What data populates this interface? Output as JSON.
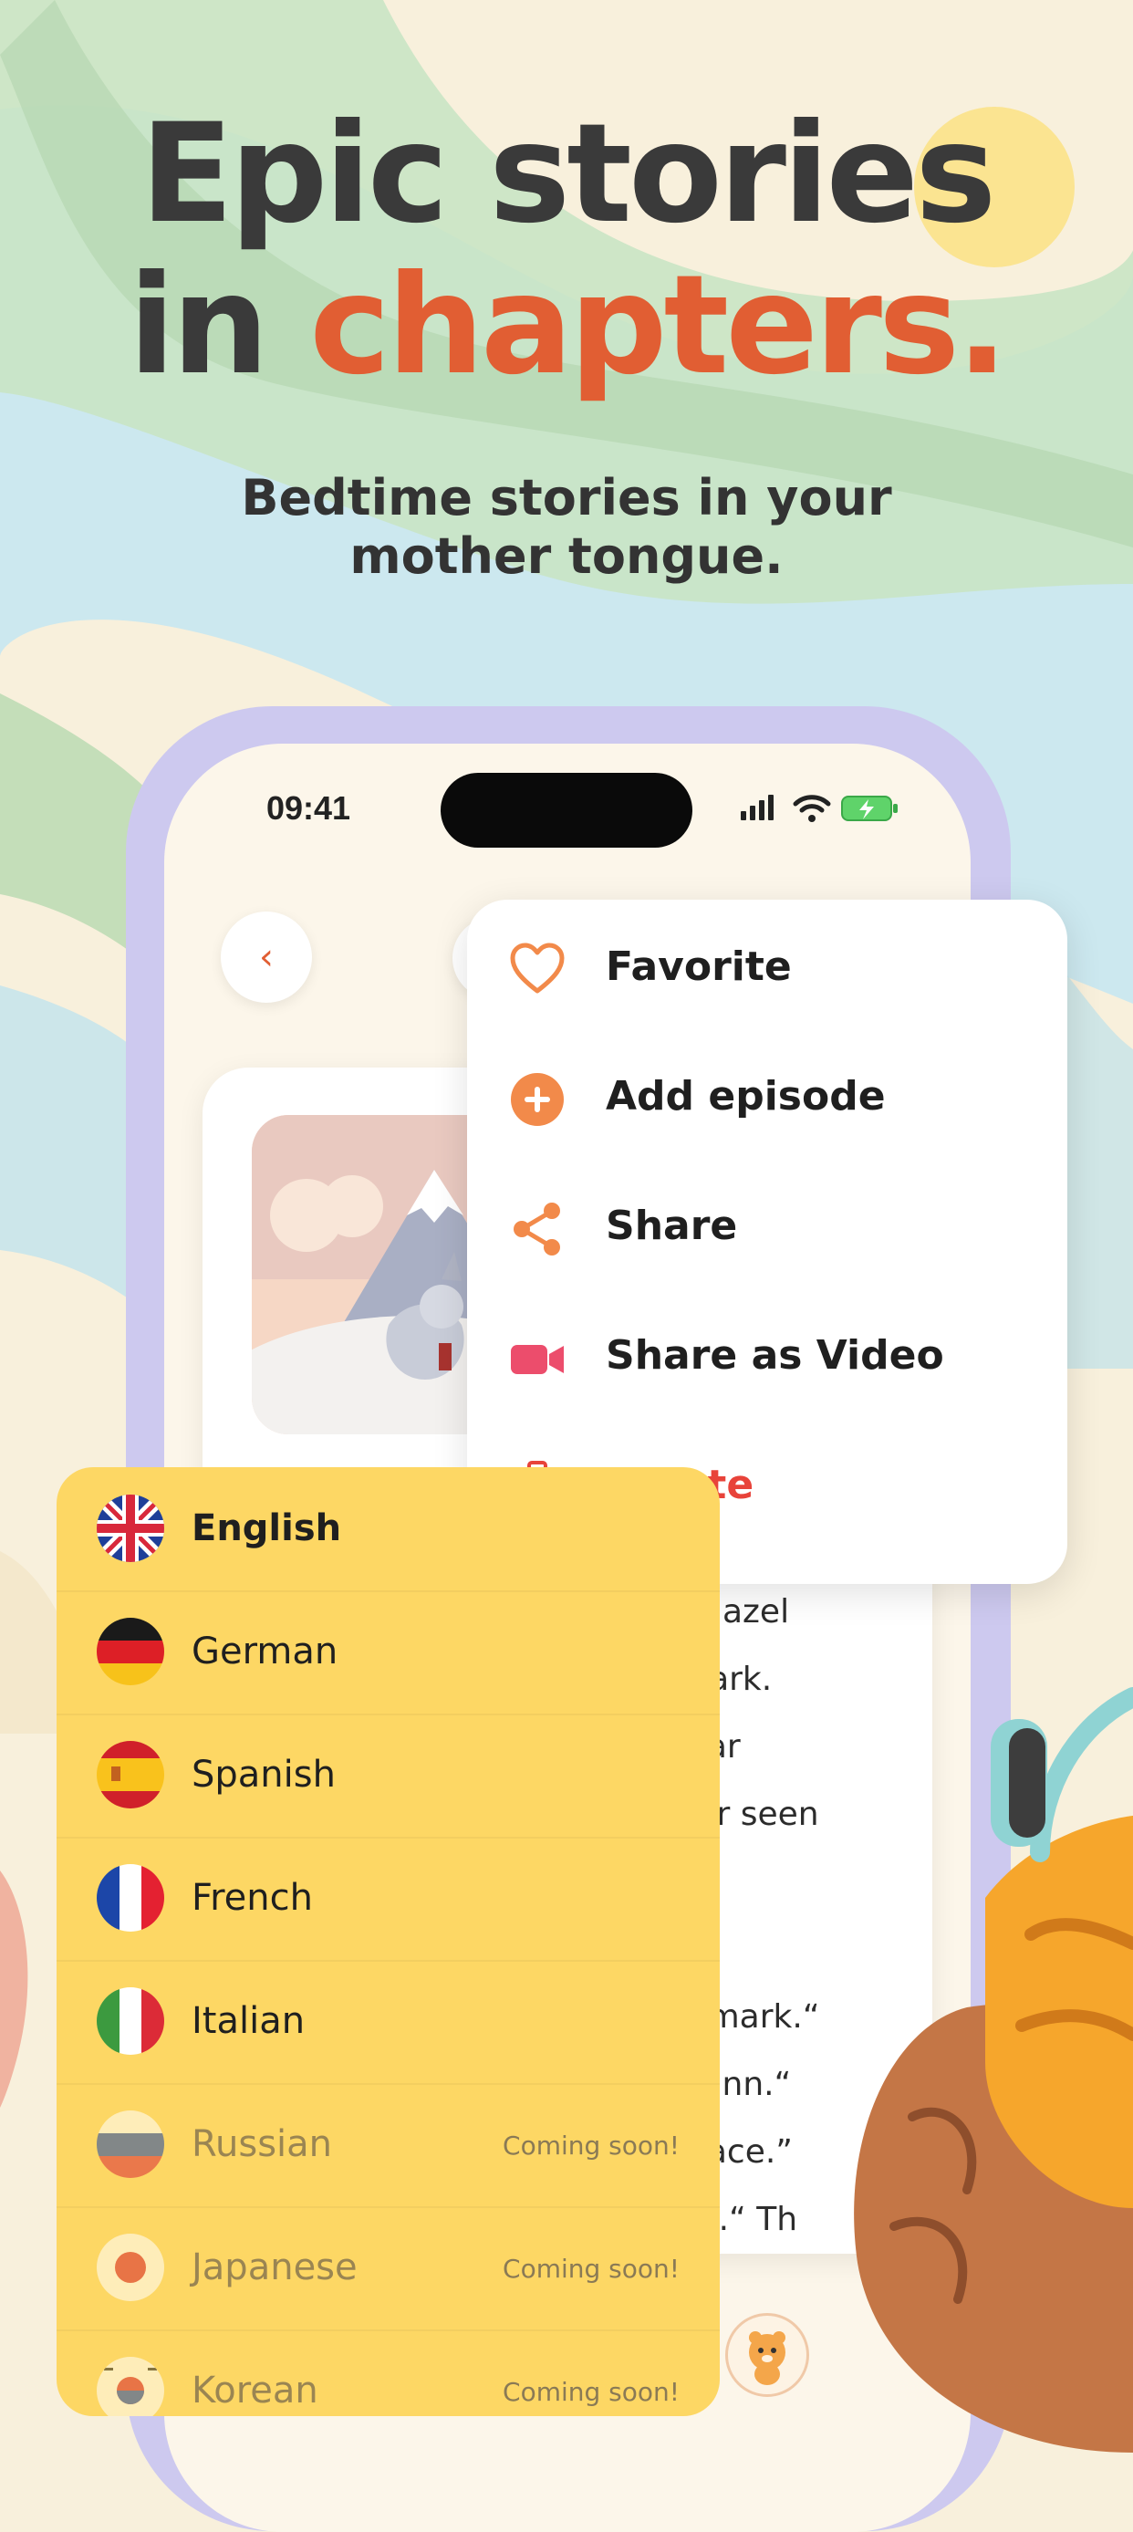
{
  "headline": {
    "line1": "Epic stories",
    "line2_prefix": "in ",
    "line2_accent": "chapters."
  },
  "subheadline": {
    "line1": "Bedtime stories in your",
    "line2": "mother tongue."
  },
  "status_bar": {
    "time": "09:41"
  },
  "story": {
    "text_lines": [
      ", Hazel",
      "mark.",
      "star",
      "ver seen",
      "",
      "",
      "e mark.“",
      "l Finn.“",
      "place.”",
      "up.“ Th"
    ]
  },
  "menu": {
    "items": [
      {
        "label": "Favorite",
        "icon": "heart-icon"
      },
      {
        "label": "Add episode",
        "icon": "plus-circle-icon"
      },
      {
        "label": "Share",
        "icon": "share-icon"
      },
      {
        "label": "Share as Video",
        "icon": "video-camera-icon"
      },
      {
        "label": "Delete",
        "icon": "trash-icon"
      }
    ]
  },
  "languages": {
    "items": [
      {
        "name": "English",
        "flag": "uk-flag-icon",
        "selected": true
      },
      {
        "name": "German",
        "flag": "germany-flag-icon"
      },
      {
        "name": "Spanish",
        "flag": "spain-flag-icon"
      },
      {
        "name": "French",
        "flag": "france-flag-icon"
      },
      {
        "name": "Italian",
        "flag": "italy-flag-icon"
      },
      {
        "name": "Russian",
        "flag": "russia-flag-icon",
        "status": "Coming soon!"
      },
      {
        "name": "Japanese",
        "flag": "japan-flag-icon",
        "status": "Coming soon!"
      },
      {
        "name": "Korean",
        "flag": "korea-flag-icon",
        "status": "Coming soon!"
      }
    ]
  },
  "colors": {
    "accent": "#e15e33",
    "menu_icon": "#f28a4a",
    "video_icon": "#ec4d6c",
    "danger": "#e8433a",
    "language_panel": "#fdd764",
    "phone_frame": "#cdc9ef"
  }
}
